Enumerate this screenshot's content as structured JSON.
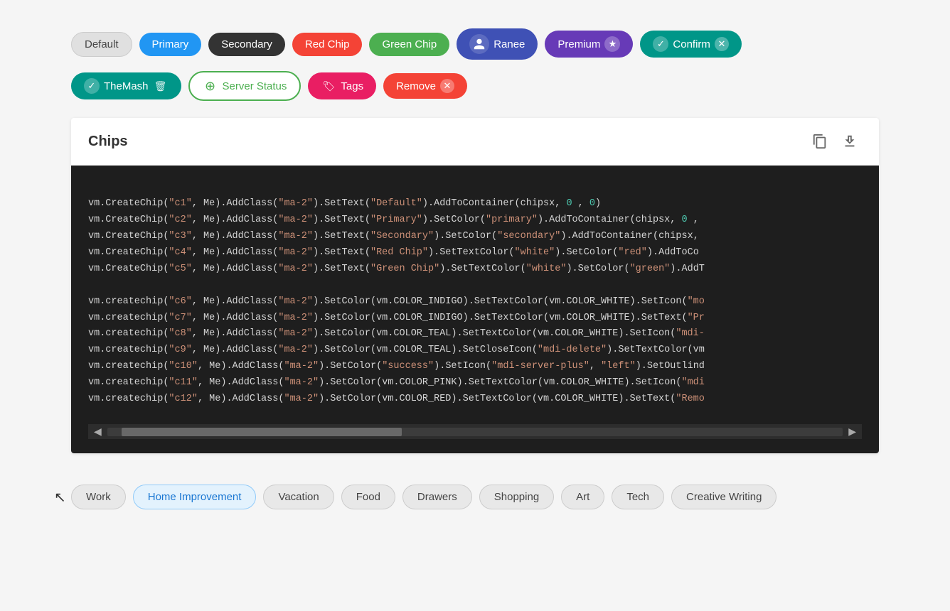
{
  "chips_row1": [
    {
      "id": "c1",
      "label": "Default",
      "style": "default"
    },
    {
      "id": "c2",
      "label": "Primary",
      "style": "primary"
    },
    {
      "id": "c3",
      "label": "Secondary",
      "style": "secondary"
    },
    {
      "id": "c4",
      "label": "Red Chip",
      "style": "red"
    },
    {
      "id": "c5",
      "label": "Green Chip",
      "style": "green"
    },
    {
      "id": "c6",
      "label": "Ranee",
      "style": "ranee",
      "icon": "person"
    },
    {
      "id": "c7",
      "label": "Premium",
      "style": "premium",
      "icon": "star"
    },
    {
      "id": "c8",
      "label": "Confirm",
      "style": "confirm",
      "icon": "check",
      "close": true
    }
  ],
  "chips_row2": [
    {
      "id": "c9",
      "label": "TheMash",
      "style": "themash",
      "icon": "check",
      "close": "trash"
    },
    {
      "id": "c10",
      "label": "Server Status",
      "style": "server",
      "icon": "plus"
    },
    {
      "id": "c11",
      "label": "Tags",
      "style": "tags",
      "icon": "bookmark"
    },
    {
      "id": "c12",
      "label": "Remove",
      "style": "remove",
      "close": true
    }
  ],
  "code_section": {
    "title": "Chips",
    "copy_icon": "📋",
    "download_icon": "⬇",
    "lines": [
      "vm.CreateChip(\"c1\", Me).AddClass(\"ma-2\").SetText(\"Default\").AddToContainer(chipsx, 0 , 0)",
      "vm.CreateChip(\"c2\", Me).AddClass(\"ma-2\").SetText(\"Primary\").SetColor(\"primary\").AddToContainer(chipsx, 0 ,",
      "vm.CreateChip(\"c3\", Me).AddClass(\"ma-2\").SetText(\"Secondary\").SetColor(\"secondary\").AddToContainer(chipsx,",
      "vm.CreateChip(\"c4\", Me).AddClass(\"ma-2\").SetText(\"Red Chip\").SetTextColor(\"white\").SetColor(\"red\").AddToCo",
      "vm.CreateChip(\"c5\", Me).AddClass(\"ma-2\").SetText(\"Green Chip\").SetTextColor(\"white\").SetColor(\"green\").AddT",
      " ",
      "vm.createchip(\"c6\", Me).AddClass(\"ma-2\").SetColor(vm.COLOR_INDIGO).SetTextColor(vm.COLOR_WHITE).SetIcon(\"mo",
      "vm.createchip(\"c7\", Me).AddClass(\"ma-2\").SetColor(vm.COLOR_INDIGO).SetTextColor(vm.COLOR_WHITE).SetText(\"Pr",
      "vm.createchip(\"c8\", Me).AddClass(\"ma-2\").SetColor(vm.COLOR_TEAL).SetTextColor(vm.COLOR_WHITE).SetIcon(\"mdi-",
      "vm.createchip(\"c9\", Me).AddClass(\"ma-2\").SetColor(vm.COLOR_TEAL).SetCloseIcon(\"mdi-delete\").SetTextColor(vm",
      "vm.createchip(\"c10\", Me).AddClass(\"ma-2\").SetColor(\"success\").SetIcon(\"mdi-server-plus\", \"left\").SetOutlind",
      "vm.createchip(\"c11\", Me).AddClass(\"ma-2\").SetColor(vm.COLOR_PINK).SetTextColor(vm.COLOR_WHITE).SetIcon(\"mdi",
      "vm.createchip(\"c12\", Me).AddClass(\"ma-2\").SetColor(vm.COLOR_RED).SetTextColor(vm.COLOR_WHITE).SetText(\"Remo"
    ]
  },
  "bottom_tags": [
    {
      "id": "t1",
      "label": "Work",
      "active": false
    },
    {
      "id": "t2",
      "label": "Home Improvement",
      "active": true
    },
    {
      "id": "t3",
      "label": "Vacation",
      "active": false
    },
    {
      "id": "t4",
      "label": "Food",
      "active": false
    },
    {
      "id": "t5",
      "label": "Drawers",
      "active": false
    },
    {
      "id": "t6",
      "label": "Shopping",
      "active": false
    },
    {
      "id": "t7",
      "label": "Art",
      "active": false
    },
    {
      "id": "t8",
      "label": "Tech",
      "active": false
    },
    {
      "id": "t9",
      "label": "Creative Writing",
      "active": false
    }
  ]
}
